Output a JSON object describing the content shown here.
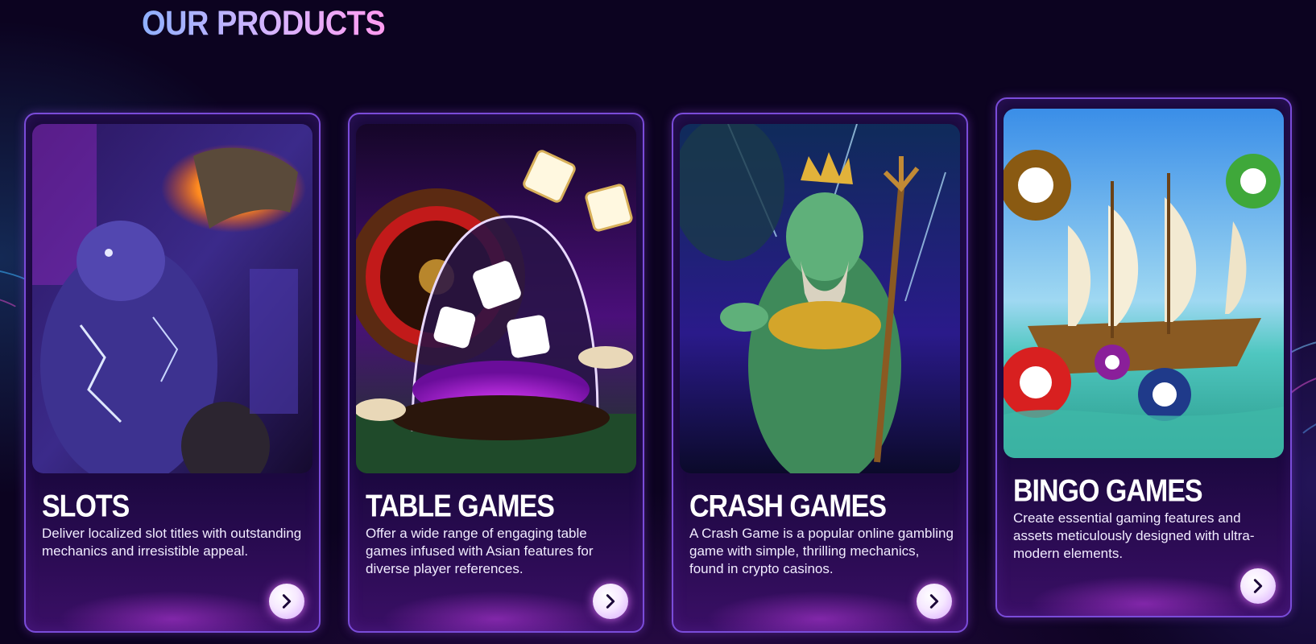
{
  "section": {
    "title": "OUR PRODUCTS"
  },
  "colors": {
    "accent": "#b07cff",
    "background": "#0c0320",
    "title_gradient_start": "#8fb0ff",
    "title_gradient_end": "#ff9bf0"
  },
  "products": [
    {
      "title": "SLOTS",
      "description": "Deliver localized slot titles with outstanding mechanics and irresistible appeal.",
      "icon": "chevron-right-icon"
    },
    {
      "title": "TABLE GAMES",
      "description": "Offer a wide range of engaging table games infused with Asian features for diverse player references.",
      "icon": "chevron-right-icon"
    },
    {
      "title": "CRASH GAMES",
      "description": "A Crash Game is a popular online gambling game with simple, thrilling mechanics, found in crypto casinos.",
      "icon": "chevron-right-icon"
    },
    {
      "title": "BINGO GAMES",
      "description": "Create essential gaming features and assets meticulously designed with ultra-modern elements.",
      "icon": "chevron-right-icon"
    }
  ]
}
